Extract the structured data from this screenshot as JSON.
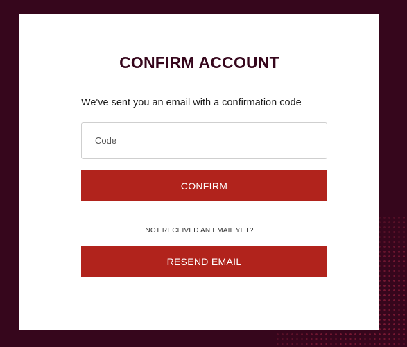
{
  "title": "CONFIRM ACCOUNT",
  "subtitle": "We've sent you an email with a confirmation code",
  "code_input": {
    "placeholder": "Code",
    "value": ""
  },
  "confirm_button_label": "CONFIRM",
  "resend_prompt": "NOT RECEIVED AN EMAIL YET?",
  "resend_button_label": "RESEND EMAIL",
  "colors": {
    "background": "#36061c",
    "card": "#ffffff",
    "primary_button": "#b1231c",
    "title_text": "#36061c"
  }
}
